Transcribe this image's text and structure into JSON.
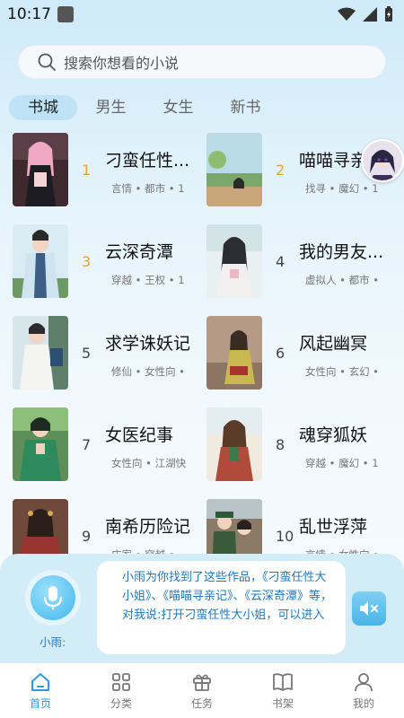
{
  "status_bar": {
    "time": "10:17"
  },
  "search": {
    "placeholder": "搜索你想看的小说"
  },
  "tabs": [
    {
      "label": "书城",
      "active": true
    },
    {
      "label": "男生",
      "active": false
    },
    {
      "label": "女生",
      "active": false
    },
    {
      "label": "新书",
      "active": false
    }
  ],
  "books": [
    {
      "rank": "1",
      "title": "刁蛮任性...",
      "tags": "言情 • 都市 • 1",
      "hot": true
    },
    {
      "rank": "2",
      "title": "喵喵寻亲记",
      "tags": "找寻 • 魔幻 • 1",
      "hot": true
    },
    {
      "rank": "3",
      "title": "云深奇潭",
      "tags": "穿越 • 王权 • 1",
      "hot": true
    },
    {
      "rank": "4",
      "title": "我的男友...",
      "tags": "虚拟人 • 都市 •",
      "hot": false
    },
    {
      "rank": "5",
      "title": "求学诛妖记",
      "tags": "修仙 • 女性向 •",
      "hot": false
    },
    {
      "rank": "6",
      "title": "风起幽冥",
      "tags": "女性向 • 玄幻 •",
      "hot": false
    },
    {
      "rank": "7",
      "title": "女医纪事",
      "tags": "女性向 • 江湖快",
      "hot": false
    },
    {
      "rank": "8",
      "title": "魂穿狐妖",
      "tags": "穿越 • 魔幻 • 1",
      "hot": false
    },
    {
      "rank": "9",
      "title": "南希历险记",
      "tags": "庄家 • 穿越 •",
      "hot": false
    },
    {
      "rank": "10",
      "title": "乱世浮萍",
      "tags": "言情 • 女性向 •",
      "hot": false
    }
  ],
  "assistant": {
    "name": "小雨:",
    "message": "小雨为你找到了这些作品，《刁蛮任性大小姐》、《喵喵寻亲记》、《云深奇潭》等，对我说:打开刁蛮任性大小姐，可以进入"
  },
  "bottom_nav": [
    {
      "label": "首页",
      "icon": "home-icon",
      "active": true
    },
    {
      "label": "分类",
      "icon": "grid-icon",
      "active": false
    },
    {
      "label": "任务",
      "icon": "gift-icon",
      "active": false
    },
    {
      "label": "书架",
      "icon": "book-icon",
      "active": false
    },
    {
      "label": "我的",
      "icon": "user-icon",
      "active": false
    }
  ],
  "colors": {
    "accent": "#2b9be0",
    "rank_hot": "#e9a23b",
    "assistant_text": "#1a78c9"
  }
}
